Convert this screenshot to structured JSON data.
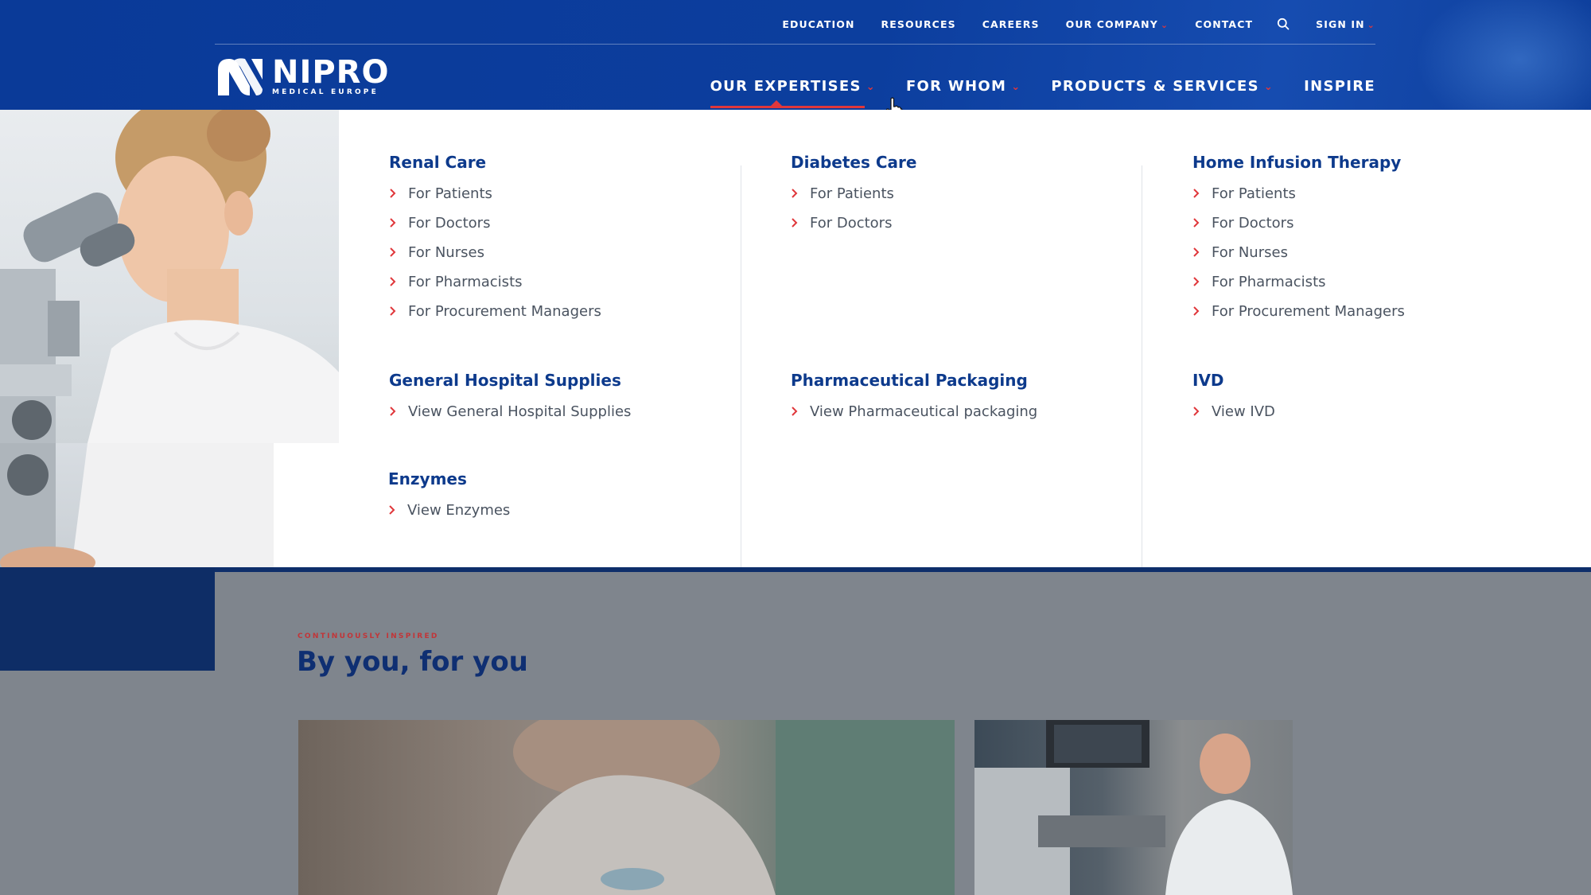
{
  "brand": {
    "name": "NIPRO",
    "tagline": "MEDICAL EUROPE"
  },
  "utility_nav": {
    "items": [
      {
        "label": "EDUCATION"
      },
      {
        "label": "RESOURCES"
      },
      {
        "label": "CAREERS"
      },
      {
        "label": "OUR COMPANY"
      },
      {
        "label": "CONTACT"
      }
    ],
    "sign_in": "SIGN IN",
    "search_icon": "search-icon"
  },
  "main_nav": {
    "items": [
      {
        "label": "OUR EXPERTISES",
        "active": true
      },
      {
        "label": "FOR WHOM"
      },
      {
        "label": "PRODUCTS & SERVICES"
      },
      {
        "label": "INSPIRE"
      }
    ]
  },
  "mega_menu": {
    "columns": [
      {
        "groups": [
          {
            "title": "Renal Care",
            "links": [
              "For Patients",
              "For Doctors",
              "For Nurses",
              "For Pharmacists",
              "For Procurement Managers"
            ]
          },
          {
            "title": "General Hospital Supplies",
            "links": [
              "View General Hospital Supplies"
            ]
          },
          {
            "title": "Enzymes",
            "links": [
              "View Enzymes"
            ]
          }
        ]
      },
      {
        "groups": [
          {
            "title": "Diabetes Care",
            "links": [
              "For Patients",
              "For Doctors"
            ]
          },
          {
            "title": "Pharmaceutical Packaging",
            "links": [
              "View Pharmaceutical packaging"
            ]
          }
        ]
      },
      {
        "groups": [
          {
            "title": "Home Infusion Therapy",
            "links": [
              "For Patients",
              "For Doctors",
              "For Nurses",
              "For Pharmacists",
              "For Procurement Managers"
            ]
          },
          {
            "title": "IVD",
            "links": [
              "View IVD"
            ]
          }
        ]
      }
    ]
  },
  "section": {
    "kicker": "CONTINUOUSLY INSPIRED",
    "title": "By you, for you"
  },
  "colors": {
    "header_blue": "#0c3e9e",
    "accent_red": "#e0373b",
    "title_navy": "#0d3a8c",
    "link_gray": "#4a5360"
  }
}
